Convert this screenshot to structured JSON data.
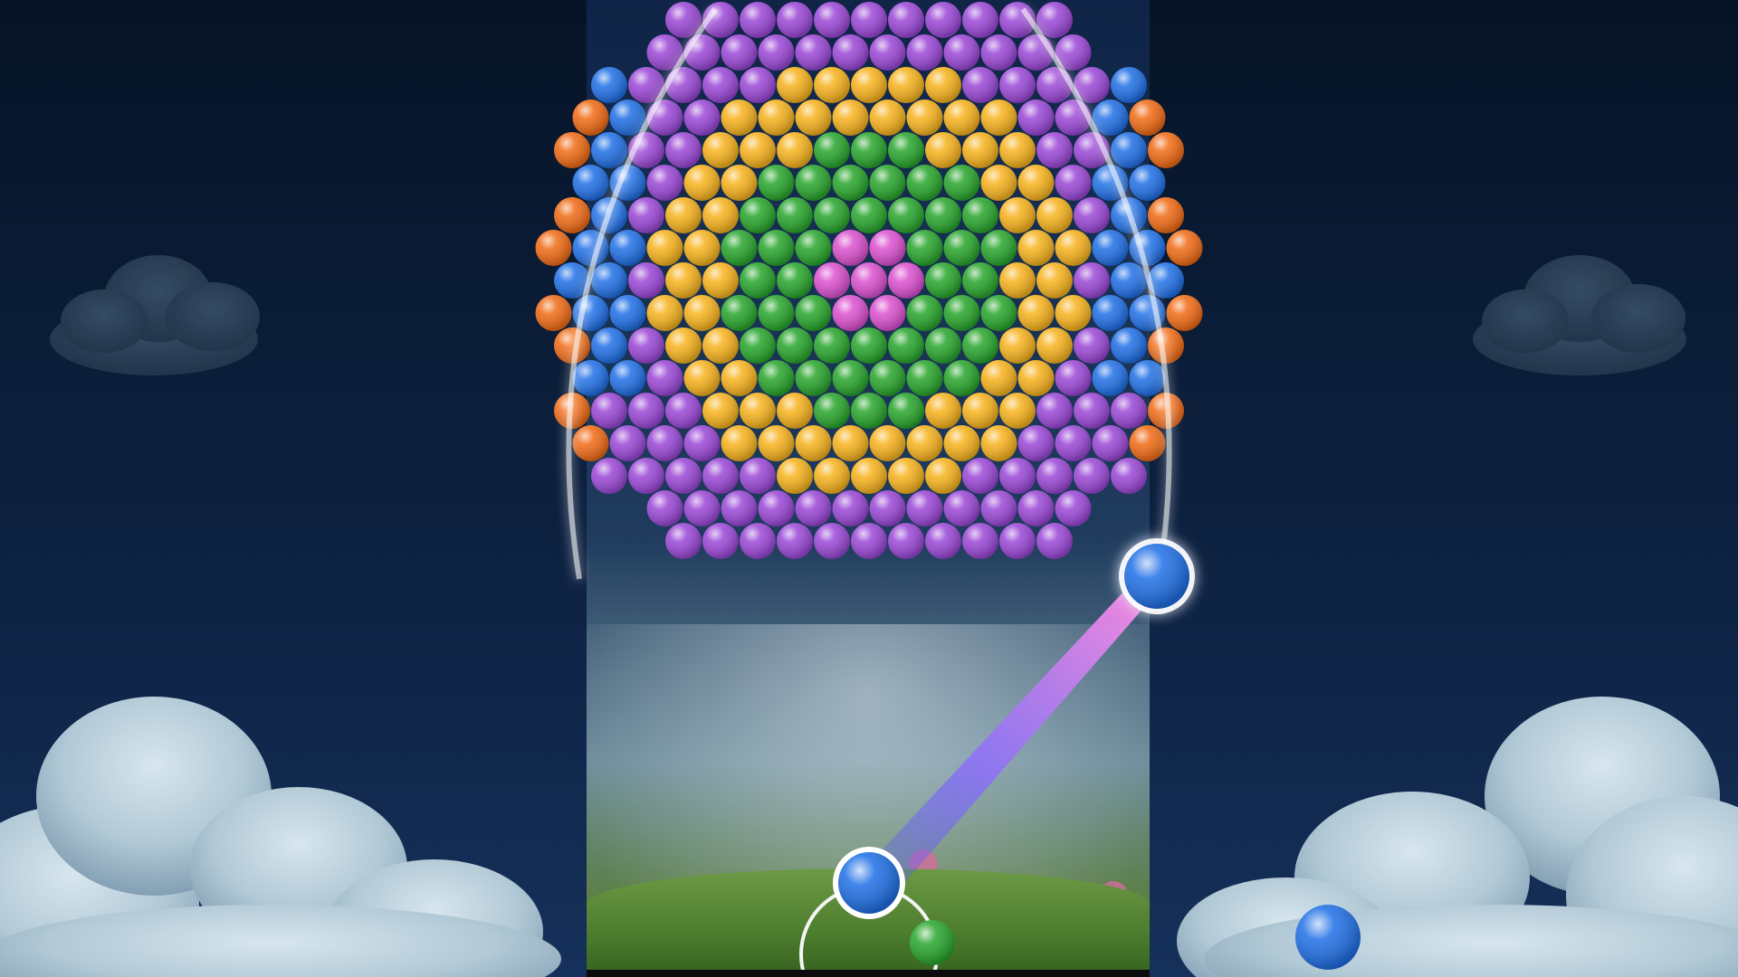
{
  "game": {
    "palette": {
      "blue": "#1f6fe6",
      "purple": "#9a46d6",
      "yellow": "#f7b21c",
      "green": "#27a52b",
      "pink": "#db4fcf",
      "orange": "#f06a14"
    },
    "current_shot_color": "blue",
    "next_bubble_color": "green",
    "extra_bubble_color": "blue",
    "projectile_color": "blue"
  }
}
